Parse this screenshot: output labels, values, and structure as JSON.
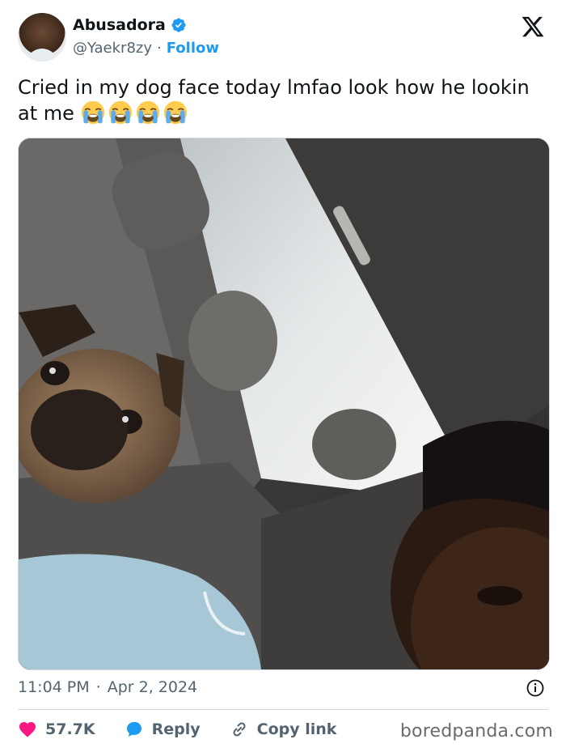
{
  "author": {
    "name": "Abusadora",
    "handle": "@Yaekr8zy",
    "separator": "·",
    "follow_label": "Follow"
  },
  "tweet": {
    "text": "Cried in my dog face today lmfao look how he lookin at me",
    "emojis": [
      "loudly-crying-face",
      "loudly-crying-face",
      "loudly-crying-face",
      "loudly-crying-face"
    ],
    "time": "11:04 PM",
    "date_separator": "·",
    "date": "Apr 2, 2024"
  },
  "actions": {
    "likes": "57.7K",
    "reply_label": "Reply",
    "copy_link_label": "Copy link"
  },
  "watermark": "boredpanda.com",
  "colors": {
    "accent": "#1d9bf0",
    "like": "#f91880",
    "text": "#0f1419",
    "muted": "#536471"
  }
}
